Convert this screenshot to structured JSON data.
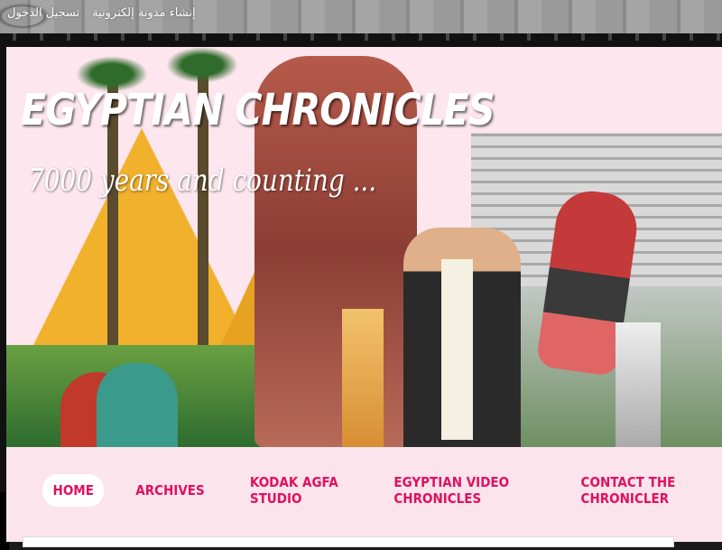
{
  "navbar": {
    "create_blog": "إنشاء مدونة إلكترونية",
    "sign_in": "تسجيل الدخول"
  },
  "header": {
    "title": "EGYPTIAN CHRONICLES",
    "tagline": "7000 years and counting ..."
  },
  "menu": {
    "items": [
      {
        "label": "HOME",
        "active": true
      },
      {
        "label": "ARCHIVES",
        "active": false
      },
      {
        "label": "KODAK AGFA STUDIO",
        "active": false
      },
      {
        "label": "EGYPTIAN VIDEO CHRONICLES",
        "active": false
      },
      {
        "label": "CONTACT THE CHRONICLER",
        "active": false
      }
    ]
  },
  "colors": {
    "accent": "#e0115f",
    "background": "#fce4ec"
  }
}
